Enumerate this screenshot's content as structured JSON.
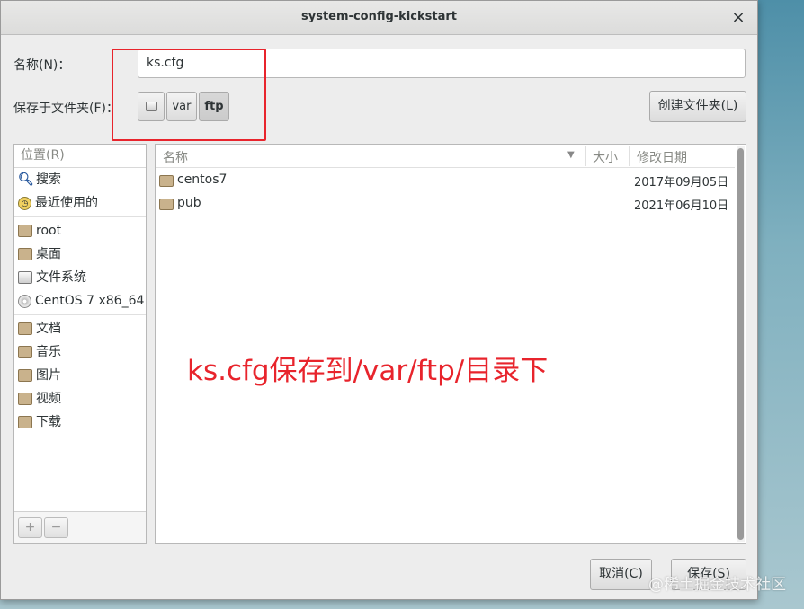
{
  "window": {
    "title": "system-config-kickstart",
    "close_symbol": "×"
  },
  "form": {
    "name_label": "名称(N)：",
    "name_value": "ks.cfg",
    "save_in_label": "保存于文件夹(F)：",
    "path_segments": [
      {
        "label": "",
        "icon": "disk-icon"
      },
      {
        "label": "var"
      },
      {
        "label": "ftp",
        "active": true
      }
    ],
    "create_folder_label": "创建文件夹(L)"
  },
  "places": {
    "header": "位置(R)",
    "items": [
      {
        "label": "搜索",
        "icon": "search-icon"
      },
      {
        "label": "最近使用的",
        "icon": "recent-icon"
      },
      {
        "label": "root",
        "icon": "home-folder-icon"
      },
      {
        "label": "桌面",
        "icon": "desktop-folder-icon"
      },
      {
        "label": "文件系统",
        "icon": "filesystem-icon"
      },
      {
        "label": "CentOS 7 x86_64",
        "icon": "cdrom-icon"
      },
      {
        "label": "文档",
        "icon": "documents-folder-icon"
      },
      {
        "label": "音乐",
        "icon": "music-folder-icon"
      },
      {
        "label": "图片",
        "icon": "pictures-folder-icon"
      },
      {
        "label": "视频",
        "icon": "videos-folder-icon"
      },
      {
        "label": "下载",
        "icon": "downloads-folder-icon"
      }
    ],
    "add_symbol": "+",
    "remove_symbol": "−"
  },
  "files": {
    "columns": {
      "name": "名称",
      "size": "大小",
      "modified": "修改日期"
    },
    "sort_symbol": "▼",
    "rows": [
      {
        "name": "centos7",
        "size": "",
        "modified": "2017年09月05日",
        "icon": "folder-icon"
      },
      {
        "name": "pub",
        "size": "",
        "modified": "2021年06月10日",
        "icon": "folder-icon"
      }
    ]
  },
  "annotation": {
    "text": "ks.cfg保存到/var/ftp/目录下",
    "color": "#e8242c"
  },
  "buttons": {
    "cancel": "取消(C)",
    "save": "保存(S)"
  },
  "watermark": "@稀土掘金技术社区"
}
